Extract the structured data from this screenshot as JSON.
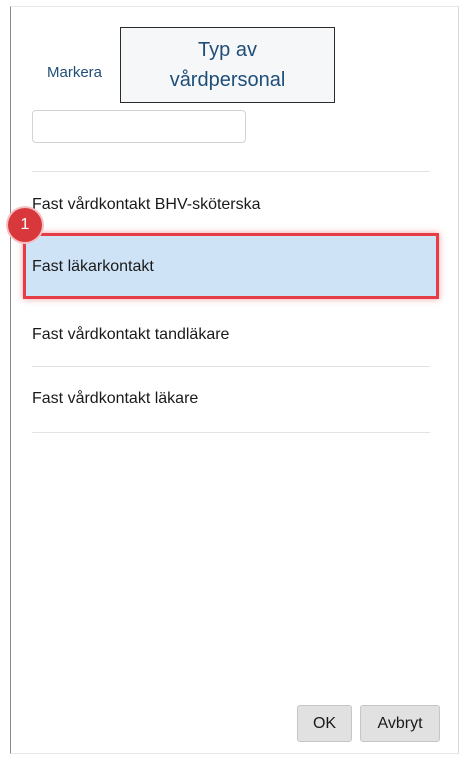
{
  "header": {
    "select_link": "Markera",
    "title": "Typ av vårdpersonal"
  },
  "search": {
    "value": "",
    "placeholder": ""
  },
  "list": {
    "items": [
      {
        "label": "Fast vårdkontakt BHV-sköterska",
        "selected": false
      },
      {
        "label": "Fast läkarkontakt",
        "selected": true
      },
      {
        "label": "Fast vårdkontakt tandläkare",
        "selected": false
      },
      {
        "label": "Fast vårdkontakt läkare",
        "selected": false
      }
    ]
  },
  "annotation": {
    "step_number": "1",
    "color": "#e53d45"
  },
  "footer": {
    "ok_label": "OK",
    "cancel_label": "Avbryt"
  },
  "colors": {
    "selected_background": "#cfe3f7",
    "link": "#1f4e79"
  }
}
